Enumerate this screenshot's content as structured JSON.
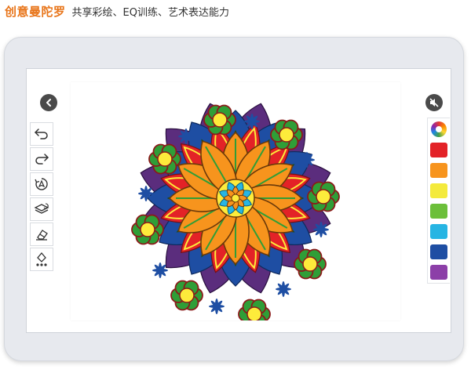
{
  "header": {
    "brand": "创意曼陀罗",
    "tagline": "共享彩绘、EQ训练、艺术表达能力"
  },
  "toolbar": {
    "tools": [
      {
        "name": "undo-icon"
      },
      {
        "name": "redo-icon"
      },
      {
        "name": "rotate-icon"
      },
      {
        "name": "layers-icon"
      },
      {
        "name": "eraser-icon"
      },
      {
        "name": "fill-bucket-icon"
      }
    ]
  },
  "palette": {
    "icon": "color-wheel-icon",
    "colors": [
      "#e32227",
      "#f7941d",
      "#f4ea3c",
      "#6cbf3a",
      "#27b5e3",
      "#1e4ea3",
      "#8c3fa8"
    ]
  },
  "mandala_colors": {
    "orange": "#f7941d",
    "dark_orange": "#e8751a",
    "yellow": "#fdeb3b",
    "green": "#2f9e37",
    "red": "#e32227",
    "blue": "#1e4ea3",
    "purple": "#5b2d7d",
    "cyan": "#27b5e3",
    "brown": "#8b1a1a"
  }
}
